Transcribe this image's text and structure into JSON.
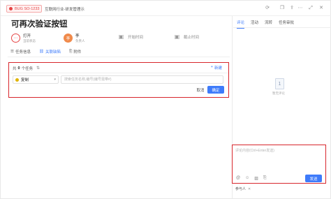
{
  "topbar": {
    "tag_text": "BUG SO-1233",
    "breadcrumb": "互联网行业-研发管理示",
    "icons": [
      "history-icon",
      "copy-icon",
      "share-icon",
      "more-icon",
      "maximize-icon",
      "close-icon"
    ]
  },
  "task": {
    "title": "可再次验证按钮",
    "status": {
      "value": "打开",
      "label": "当前状态"
    },
    "assignee": {
      "avatar_text": "李",
      "name": "李",
      "label": "负责人"
    },
    "start_time": {
      "placeholder": "开始时间"
    },
    "end_time": {
      "placeholder": "截止时间"
    }
  },
  "tabs": [
    {
      "label": "任务信息",
      "active": false
    },
    {
      "label": "关联缺陷",
      "active": true
    },
    {
      "label": "附件",
      "active": false
    }
  ],
  "relations": {
    "prefix": "共",
    "count": "0",
    "suffix": "个任务",
    "new_label": "新建",
    "type_value": "复制",
    "search_placeholder": "搜索任务名称,编号(编号需带#)",
    "cancel_label": "取消",
    "ok_label": "确定"
  },
  "right_tabs": [
    {
      "label": "评论",
      "active": true
    },
    {
      "label": "活动",
      "active": false
    },
    {
      "label": "流转",
      "active": false
    },
    {
      "label": "任务审批",
      "active": false
    }
  ],
  "comments": {
    "empty_text": "暂无评论",
    "input_placeholder": "评论内容(Ctrl+Enter发送)",
    "send_label": "发送",
    "participants_label": "参与人"
  },
  "colors": {
    "accent": "#3e7bfa",
    "bug_red": "#e64545",
    "highlight": "#d8262c",
    "avatar": "#f08a4b"
  }
}
